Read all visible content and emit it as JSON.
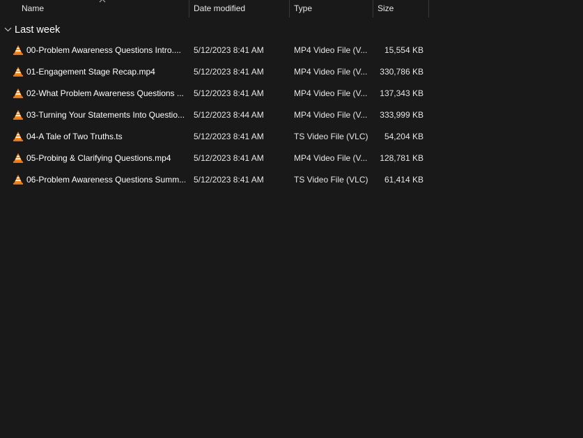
{
  "columns": {
    "name": "Name",
    "date": "Date modified",
    "type": "Type",
    "size": "Size"
  },
  "group": {
    "label": "Last week"
  },
  "icons": {
    "file": "vlc-cone-icon",
    "chevron": "chevron-down-icon",
    "sort": "sort-up-icon"
  },
  "rows": [
    {
      "name": "00-Problem Awareness Questions Intro....",
      "date": "5/12/2023 8:41 AM",
      "type": "MP4 Video File (V...",
      "size": "15,554 KB"
    },
    {
      "name": "01-Engagement Stage Recap.mp4",
      "date": "5/12/2023 8:41 AM",
      "type": "MP4 Video File (V...",
      "size": "330,786 KB"
    },
    {
      "name": "02-What Problem Awareness Questions ...",
      "date": "5/12/2023 8:41 AM",
      "type": "MP4 Video File (V...",
      "size": "137,343 KB"
    },
    {
      "name": "03-Turning Your Statements Into Questio...",
      "date": "5/12/2023 8:44 AM",
      "type": "MP4 Video File (V...",
      "size": "333,999 KB"
    },
    {
      "name": "04-A Tale of Two Truths.ts",
      "date": "5/12/2023 8:41 AM",
      "type": "TS Video File (VLC)",
      "size": "54,204 KB"
    },
    {
      "name": "05-Probing & Clarifying Questions.mp4",
      "date": "5/12/2023 8:41 AM",
      "type": "MP4 Video File (V...",
      "size": "128,781 KB"
    },
    {
      "name": "06-Problem Awareness Questions Summ...",
      "date": "5/12/2023 8:41 AM",
      "type": "TS Video File (VLC)",
      "size": "61,414 KB"
    }
  ]
}
